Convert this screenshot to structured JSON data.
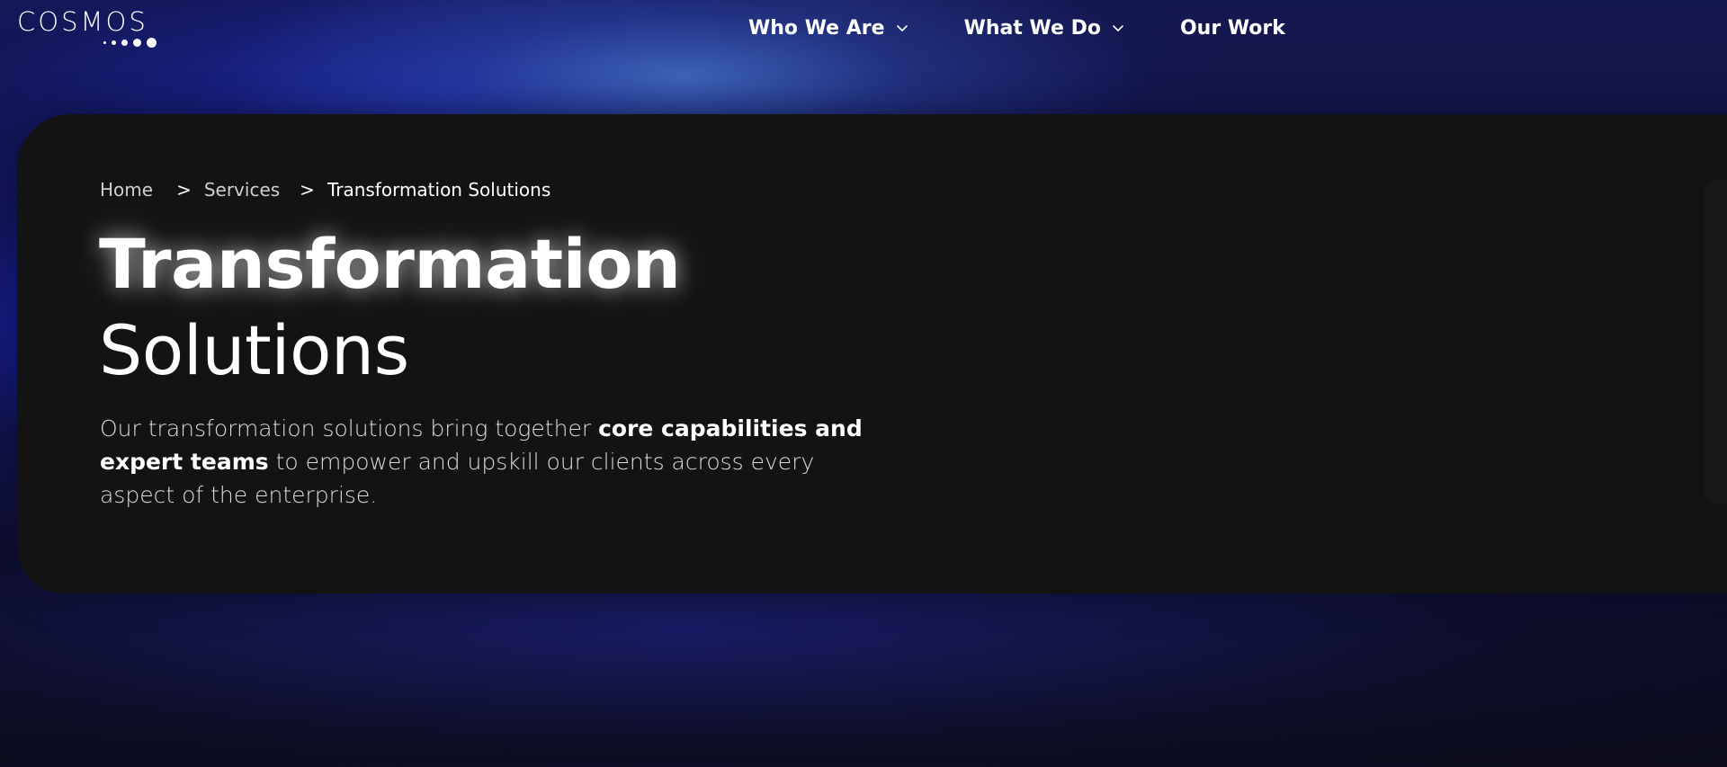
{
  "header": {
    "logo_text": "COSMOS",
    "nav": [
      {
        "label": "Who We Are",
        "has_dropdown": true
      },
      {
        "label": "What We Do",
        "has_dropdown": true
      },
      {
        "label": "Our Work",
        "has_dropdown": false
      }
    ]
  },
  "breadcrumb": {
    "items": [
      "Home",
      "Services",
      "Transformation Solutions"
    ],
    "separator": ">"
  },
  "hero": {
    "title_line1": "Transformation",
    "title_line2": "Solutions",
    "description": {
      "part1": "Our transformation solutions bring together ",
      "emphasis": "core capabilities and expert teams",
      "part2": " to empower and upskill our clients across every aspect of the enterprise."
    }
  },
  "colors": {
    "card_background": "#131313",
    "accent_blue": "#1a24c8",
    "text_primary": "#ffffff",
    "text_secondary": "#dcdcdc"
  },
  "icons": {
    "nav_dropdown": "chevron-down-icon"
  }
}
